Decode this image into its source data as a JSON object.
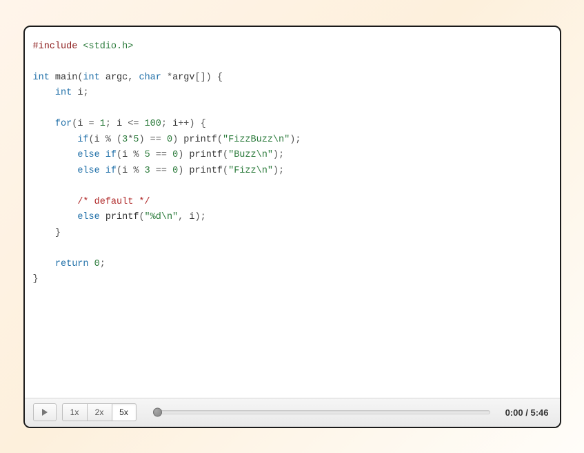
{
  "code": {
    "tokens": [
      {
        "cls": "tok-pre",
        "t": "#include"
      },
      {
        "cls": "tok-op",
        "t": " "
      },
      {
        "cls": "tok-inc",
        "t": "<stdio.h>"
      },
      {
        "nl": 1
      },
      {
        "nl": 1
      },
      {
        "cls": "tok-kw",
        "t": "int"
      },
      {
        "cls": "tok-op",
        "t": " "
      },
      {
        "cls": "tok-fn",
        "t": "main"
      },
      {
        "cls": "tok-op",
        "t": "("
      },
      {
        "cls": "tok-kw",
        "t": "int"
      },
      {
        "cls": "tok-op",
        "t": " "
      },
      {
        "cls": "tok-id",
        "t": "argc"
      },
      {
        "cls": "tok-op",
        "t": ", "
      },
      {
        "cls": "tok-kw",
        "t": "char"
      },
      {
        "cls": "tok-op",
        "t": " *"
      },
      {
        "cls": "tok-id",
        "t": "argv"
      },
      {
        "cls": "tok-op",
        "t": "[]) {"
      },
      {
        "nl": 1
      },
      {
        "cls": "tok-op",
        "t": "    "
      },
      {
        "cls": "tok-kw",
        "t": "int"
      },
      {
        "cls": "tok-op",
        "t": " "
      },
      {
        "cls": "tok-id",
        "t": "i"
      },
      {
        "cls": "tok-op",
        "t": ";"
      },
      {
        "nl": 1
      },
      {
        "nl": 1
      },
      {
        "cls": "tok-op",
        "t": "    "
      },
      {
        "cls": "tok-kw",
        "t": "for"
      },
      {
        "cls": "tok-op",
        "t": "("
      },
      {
        "cls": "tok-id",
        "t": "i"
      },
      {
        "cls": "tok-op",
        "t": " = "
      },
      {
        "cls": "tok-num",
        "t": "1"
      },
      {
        "cls": "tok-op",
        "t": "; "
      },
      {
        "cls": "tok-id",
        "t": "i"
      },
      {
        "cls": "tok-op",
        "t": " <= "
      },
      {
        "cls": "tok-num",
        "t": "100"
      },
      {
        "cls": "tok-op",
        "t": "; "
      },
      {
        "cls": "tok-id",
        "t": "i"
      },
      {
        "cls": "tok-op",
        "t": "++) {"
      },
      {
        "nl": 1
      },
      {
        "cls": "tok-op",
        "t": "        "
      },
      {
        "cls": "tok-kw",
        "t": "if"
      },
      {
        "cls": "tok-op",
        "t": "("
      },
      {
        "cls": "tok-id",
        "t": "i"
      },
      {
        "cls": "tok-op",
        "t": " % ("
      },
      {
        "cls": "tok-num",
        "t": "3"
      },
      {
        "cls": "tok-op",
        "t": "*"
      },
      {
        "cls": "tok-num",
        "t": "5"
      },
      {
        "cls": "tok-op",
        "t": ") == "
      },
      {
        "cls": "tok-num",
        "t": "0"
      },
      {
        "cls": "tok-op",
        "t": ") "
      },
      {
        "cls": "tok-fn",
        "t": "printf"
      },
      {
        "cls": "tok-op",
        "t": "("
      },
      {
        "cls": "tok-str",
        "t": "\"FizzBuzz\\n\""
      },
      {
        "cls": "tok-op",
        "t": ");"
      },
      {
        "nl": 1
      },
      {
        "cls": "tok-op",
        "t": "        "
      },
      {
        "cls": "tok-kw",
        "t": "else"
      },
      {
        "cls": "tok-op",
        "t": " "
      },
      {
        "cls": "tok-kw",
        "t": "if"
      },
      {
        "cls": "tok-op",
        "t": "("
      },
      {
        "cls": "tok-id",
        "t": "i"
      },
      {
        "cls": "tok-op",
        "t": " % "
      },
      {
        "cls": "tok-num",
        "t": "5"
      },
      {
        "cls": "tok-op",
        "t": " == "
      },
      {
        "cls": "tok-num",
        "t": "0"
      },
      {
        "cls": "tok-op",
        "t": ") "
      },
      {
        "cls": "tok-fn",
        "t": "printf"
      },
      {
        "cls": "tok-op",
        "t": "("
      },
      {
        "cls": "tok-str",
        "t": "\"Buzz\\n\""
      },
      {
        "cls": "tok-op",
        "t": ");"
      },
      {
        "nl": 1
      },
      {
        "cls": "tok-op",
        "t": "        "
      },
      {
        "cls": "tok-kw",
        "t": "else"
      },
      {
        "cls": "tok-op",
        "t": " "
      },
      {
        "cls": "tok-kw",
        "t": "if"
      },
      {
        "cls": "tok-op",
        "t": "("
      },
      {
        "cls": "tok-id",
        "t": "i"
      },
      {
        "cls": "tok-op",
        "t": " % "
      },
      {
        "cls": "tok-num",
        "t": "3"
      },
      {
        "cls": "tok-op",
        "t": " == "
      },
      {
        "cls": "tok-num",
        "t": "0"
      },
      {
        "cls": "tok-op",
        "t": ") "
      },
      {
        "cls": "tok-fn",
        "t": "printf"
      },
      {
        "cls": "tok-op",
        "t": "("
      },
      {
        "cls": "tok-str",
        "t": "\"Fizz\\n\""
      },
      {
        "cls": "tok-op",
        "t": ");"
      },
      {
        "nl": 1
      },
      {
        "nl": 1
      },
      {
        "cls": "tok-op",
        "t": "        "
      },
      {
        "cls": "tok-cmt",
        "t": "/* default */"
      },
      {
        "nl": 1
      },
      {
        "cls": "tok-op",
        "t": "        "
      },
      {
        "cls": "tok-kw",
        "t": "else"
      },
      {
        "cls": "tok-op",
        "t": " "
      },
      {
        "cls": "tok-fn",
        "t": "printf"
      },
      {
        "cls": "tok-op",
        "t": "("
      },
      {
        "cls": "tok-str",
        "t": "\"%d\\n\""
      },
      {
        "cls": "tok-op",
        "t": ", "
      },
      {
        "cls": "tok-id",
        "t": "i"
      },
      {
        "cls": "tok-op",
        "t": ");"
      },
      {
        "nl": 1
      },
      {
        "cls": "tok-op",
        "t": "    }"
      },
      {
        "nl": 1
      },
      {
        "nl": 1
      },
      {
        "cls": "tok-op",
        "t": "    "
      },
      {
        "cls": "tok-kw",
        "t": "return"
      },
      {
        "cls": "tok-op",
        "t": " "
      },
      {
        "cls": "tok-num",
        "t": "0"
      },
      {
        "cls": "tok-op",
        "t": ";"
      },
      {
        "nl": 1
      },
      {
        "cls": "tok-op",
        "t": "}"
      },
      {
        "nl": 1
      }
    ]
  },
  "controls": {
    "speeds": [
      {
        "label": "1x",
        "active": false
      },
      {
        "label": "2x",
        "active": false
      },
      {
        "label": "5x",
        "active": true
      }
    ],
    "time_current": "0:00",
    "time_total": "5:46",
    "progress_percent": 0
  }
}
